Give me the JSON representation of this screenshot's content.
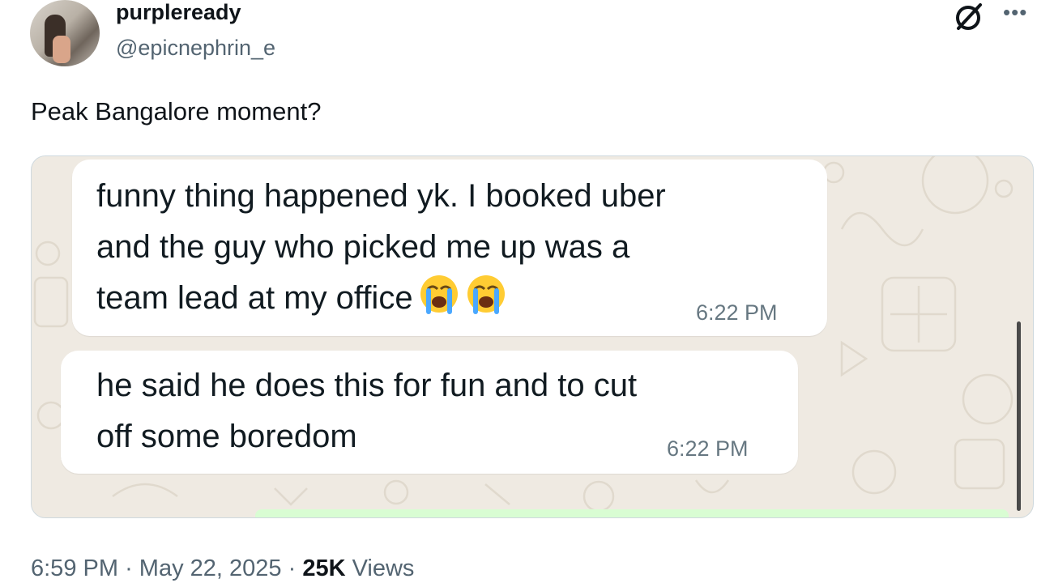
{
  "author": {
    "display_name": "purpleready",
    "handle": "@epicnephrin_e"
  },
  "tweet": {
    "text": "Peak Bangalore moment?"
  },
  "icons": {
    "grok": "grok-icon",
    "more": "more-icon",
    "crying": "loudly-crying-face-emoji"
  },
  "chat_screenshot": {
    "messages": [
      {
        "lines": [
          "funny thing happened yk. I booked uber",
          "and the guy who picked me up was a",
          "team lead at my office"
        ],
        "time": "6:22 PM"
      },
      {
        "lines": [
          "he said he does this for fun and to cut",
          "off some boredom"
        ],
        "time": "6:22 PM"
      }
    ]
  },
  "meta": {
    "time": "6:59 PM",
    "sep1": "·",
    "date": "May 22, 2025",
    "sep2": "·",
    "views_count": "25K",
    "views_label": "Views"
  },
  "colors": {
    "chat_bg": "#efeae2",
    "bubble": "#ffffff",
    "secondary_text": "#536471"
  }
}
